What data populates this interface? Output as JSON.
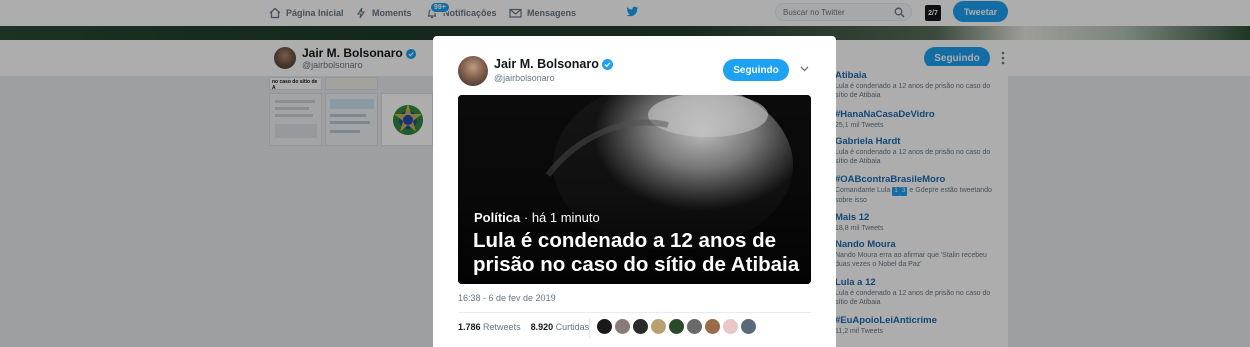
{
  "nav": {
    "home": "Página Inicial",
    "moments": "Moments",
    "notifications": "Notificações",
    "notifications_badge": "99+",
    "messages": "Mensagens",
    "search_placeholder": "Buscar no Twitter",
    "account_avatar_text": "2/7",
    "tweet_button": "Tweetar"
  },
  "profile": {
    "name": "Jair M. Bolsonaro",
    "handle": "@jairbolsonaro",
    "following_label": "Seguindo"
  },
  "media_grid": {
    "snippet": "no caso do sítio de A"
  },
  "trends": [
    {
      "title": "Atibaia",
      "desc": "Lula é condenado a 12 anos de prisão no caso do sítio de Atibaia"
    },
    {
      "title": "#HanaNaCasaDeVidro",
      "desc": "25,1 mil Tweets"
    },
    {
      "title": "Gabriela Hardt",
      "desc": "Lula é condenado a 12 anos de prisão no caso do sítio de Atibaia"
    },
    {
      "title": "#OABcontraBrasileMoro",
      "desc_pre": "Comandante Lula",
      "badge1": "1",
      "badge2": "3",
      "desc_post": "e Gdepre estão tweetando sobre isso"
    },
    {
      "title": "Mais 12",
      "desc": "18,8 mil Tweets"
    },
    {
      "title": "Nando Moura",
      "desc": "Nando Moura erra ao afirmar que 'Stalin recebeu duas vezes o Nobel da Paz'"
    },
    {
      "title": "Lula a 12",
      "desc": "Lula é condenado a 12 anos de prisão no caso do sítio de Atibaia"
    },
    {
      "title": "#EuApoioLeiAnticrime",
      "desc": "11,2 mil Tweets"
    }
  ],
  "tweet": {
    "name": "Jair M. Bolsonaro",
    "handle": "@jairbolsonaro",
    "following_label": "Seguindo",
    "card_category": "Política",
    "card_time": "· há 1 minuto",
    "card_title": "Lula é condenado a 12 anos de prisão no caso do sítio de Atibaia",
    "timestamp": "16:38 - 6 de fev de 2019",
    "retweets_count": "1.786",
    "retweets_label": "Retweets",
    "likes_count": "8.920",
    "likes_label": "Curtidas"
  },
  "colors": {
    "accent": "#1da1f2",
    "trend_link": "#1b6ab0"
  }
}
